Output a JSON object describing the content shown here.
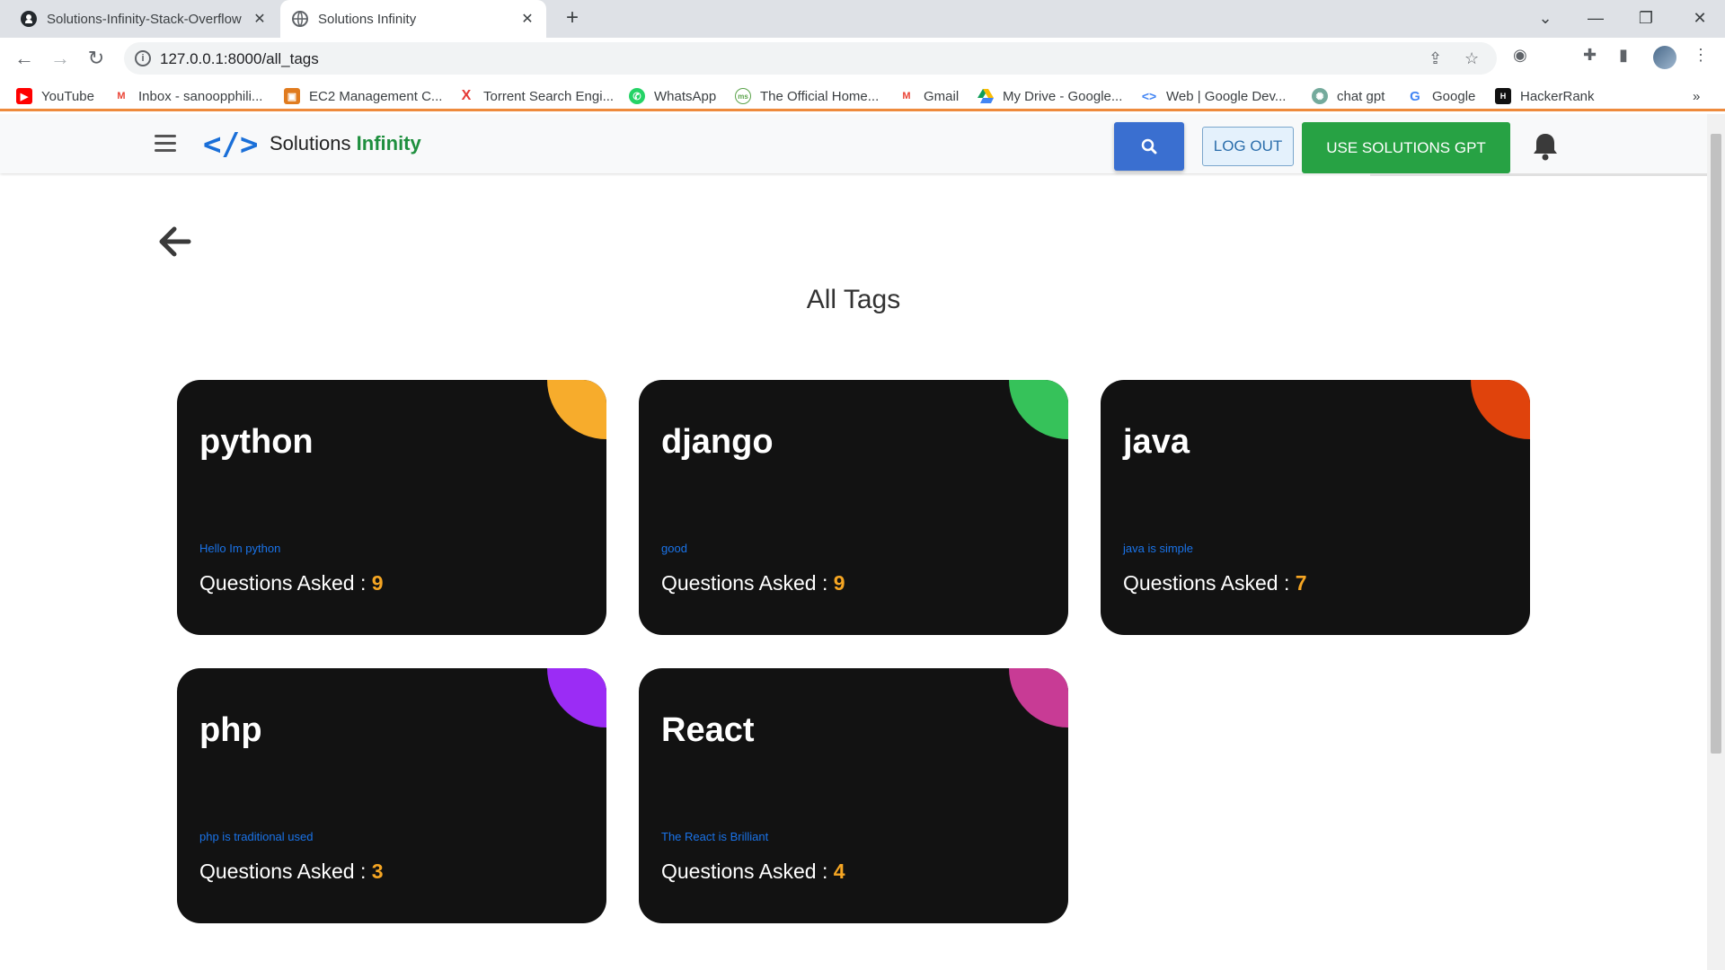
{
  "browser": {
    "tabs": [
      {
        "title": "Solutions-Infinity-Stack-Overflow",
        "active": false
      },
      {
        "title": "Solutions Infinity",
        "active": true
      }
    ],
    "url": "127.0.0.1:8000/all_tags",
    "bookmarks": [
      {
        "label": "YouTube",
        "icon": "youtube-icon",
        "color": "#ff0000"
      },
      {
        "label": "Inbox - sanoopphili...",
        "icon": "gmail-icon",
        "color": "#ea4335"
      },
      {
        "label": "EC2 Management C...",
        "icon": "aws-icon",
        "color": "#e07b1f"
      },
      {
        "label": "Torrent Search Engi...",
        "icon": "torrent-icon",
        "color": "#e53935"
      },
      {
        "label": "WhatsApp",
        "icon": "whatsapp-icon",
        "color": "#25d366"
      },
      {
        "label": "The Official Home...",
        "icon": "official-home-icon",
        "color": "#5aa34a"
      },
      {
        "label": "Gmail",
        "icon": "gmail-icon",
        "color": "#ea4335"
      },
      {
        "label": "My Drive - Google...",
        "icon": "google-drive-icon",
        "color": "#fbbc04"
      },
      {
        "label": "Web | Google Dev...",
        "icon": "google-dev-icon",
        "color": "#4285f4"
      },
      {
        "label": "chat gpt",
        "icon": "chatgpt-icon",
        "color": "#74aa9c"
      },
      {
        "label": "Google",
        "icon": "google-icon",
        "color": "#4285f4"
      },
      {
        "label": "HackerRank",
        "icon": "hackerrank-icon",
        "color": "#111111"
      }
    ],
    "overflow_label": "»"
  },
  "navbar": {
    "brand_first": "Solutions",
    "brand_second": "Infinity",
    "logout_label": "LOG OUT",
    "gpt_label": "USE SOLUTIONS GPT"
  },
  "main": {
    "title": "All Tags",
    "questions_label": "Questions Asked :",
    "tags": [
      {
        "name": "python",
        "description": "Hello Im python",
        "count": "9",
        "accent": "#f7ac2c"
      },
      {
        "name": "django",
        "description": "good",
        "count": "9",
        "accent": "#36c25a"
      },
      {
        "name": "java",
        "description": "java is simple",
        "count": "7",
        "accent": "#e0430c"
      },
      {
        "name": "php",
        "description": "php is traditional used",
        "count": "3",
        "accent": "#9b2cf5"
      },
      {
        "name": "React",
        "description": "The React is Brilliant",
        "count": "4",
        "accent": "#c83b95"
      }
    ]
  }
}
